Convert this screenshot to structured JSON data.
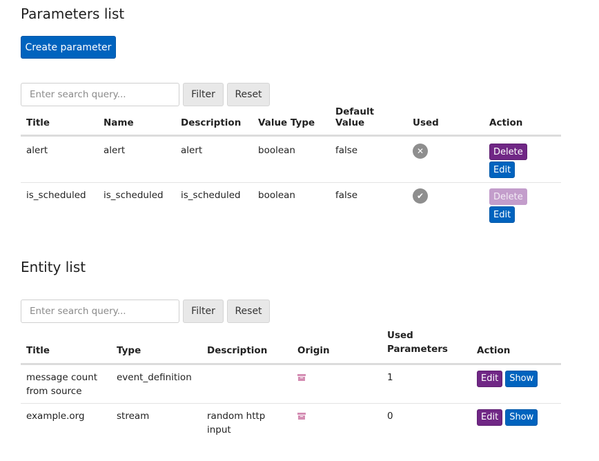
{
  "parameters": {
    "title": "Parameters list",
    "create_label": "Create parameter",
    "search_placeholder": "Enter search query...",
    "filter_label": "Filter",
    "reset_label": "Reset",
    "columns": [
      "Title",
      "Name",
      "Description",
      "Value Type",
      "Default Value",
      "Used",
      "Action"
    ],
    "rows": [
      {
        "title": "alert",
        "name": "alert",
        "description": "alert",
        "value_type": "boolean",
        "default_value": "false",
        "used": false,
        "used_icon": "x-circle-icon",
        "delete_label": "Delete",
        "delete_enabled": true,
        "edit_label": "Edit"
      },
      {
        "title": "is_scheduled",
        "name": "is_scheduled",
        "description": "is_scheduled",
        "value_type": "boolean",
        "default_value": "false",
        "used": true,
        "used_icon": "check-circle-icon",
        "delete_label": "Delete",
        "delete_enabled": false,
        "edit_label": "Edit"
      }
    ]
  },
  "entities": {
    "title": "Entity list",
    "search_placeholder": "Enter search query...",
    "filter_label": "Filter",
    "reset_label": "Reset",
    "columns": [
      "Title",
      "Type",
      "Description",
      "Origin",
      "Used Parameters",
      "Action"
    ],
    "rows": [
      {
        "title_line1": "message count",
        "title_line2": "from source",
        "type": "event_definition",
        "description_line1": "",
        "description_line2": "",
        "origin_icon": "archive-icon",
        "used_parameters": "1",
        "edit_label": "Edit",
        "show_label": "Show"
      },
      {
        "title_line1": "example.org",
        "title_line2": "",
        "type": "stream",
        "description_line1": "random http",
        "description_line2": "input",
        "origin_icon": "archive-icon",
        "used_parameters": "0",
        "edit_label": "Edit",
        "show_label": "Show"
      }
    ]
  },
  "colors": {
    "primary": "#0063be",
    "purple": "#702785",
    "purple_disabled": "#c39dcb",
    "origin_icon": "#d48db3"
  }
}
